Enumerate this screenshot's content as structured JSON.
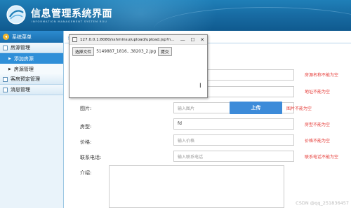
{
  "header": {
    "title": "信息管理系统界面",
    "subtitle": "INFORMATION MANAGEMENT SYSTEM ROU"
  },
  "sidebar": {
    "title": "系统菜单",
    "groups": [
      {
        "label": "房源管理",
        "items": [
          {
            "label": "添加房源",
            "active": true
          },
          {
            "label": "房源管理",
            "active": false
          }
        ]
      },
      {
        "label": "客房预定管理"
      },
      {
        "label": "消息管理"
      }
    ]
  },
  "form": {
    "image_label": "图片:",
    "image_placeholder": "输入图片",
    "upload_button": "上传",
    "image_error": "图片不能为空",
    "type_label": "房型:",
    "type_value": "fd",
    "type_error": "房型不能为空",
    "price_label": "价格:",
    "price_placeholder": "输入价格",
    "price_error": "价格不能为空",
    "phone_label": "联系电话:",
    "phone_placeholder": "输入联系电话",
    "phone_error": "联系电话不能为空",
    "intro_label": "介绍:",
    "name_error": "房源名称不能为空",
    "address_error": "地址不能为空"
  },
  "popup": {
    "url": "127.0.0.1:8080/sshminsu/upload/upload.jsp?n...",
    "choose_file": "选择文件",
    "file_name": "5149887_1816...38203_2.jpg",
    "submit": "提交"
  },
  "watermark": "CSDN @qq_251836457"
}
